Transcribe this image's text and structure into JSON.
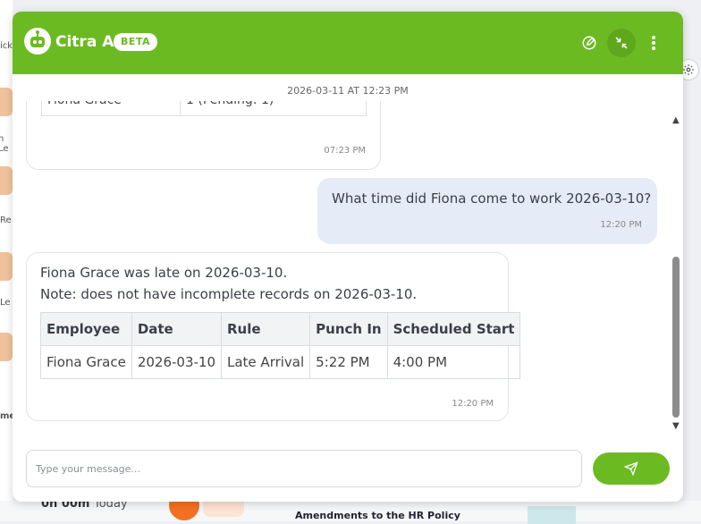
{
  "background": {
    "left_labels": [
      "ick",
      "n Le",
      "Re",
      "Le",
      "me"
    ],
    "bottom_time": "0h 00m",
    "bottom_time_suffix": "Today",
    "bottom_news": "Amendments to the HR Policy"
  },
  "chat": {
    "title": "Citra AI",
    "badge": "BETA",
    "date_separator": "2026-03-11 AT 12:23 PM",
    "messages": {
      "previous": {
        "table_row": [
          "Fiona Grace",
          "1 (Pending: 1)"
        ],
        "time": "07:23 PM"
      },
      "user": {
        "text": "What time did Fiona come to work 2026-03-10?",
        "time": "12:20 PM"
      },
      "bot": {
        "line1": "Fiona Grace was late on 2026-03-10.",
        "line2": "Note: does not have incomplete records on 2026-03-10.",
        "table": {
          "headers": [
            "Employee",
            "Date",
            "Rule",
            "Punch In",
            "Scheduled Start"
          ],
          "rows": [
            [
              "Fiona Grace",
              "2026-03-10",
              "Late Arrival",
              "5:22 PM",
              "4:00 PM"
            ]
          ]
        },
        "time": "12:20 PM"
      }
    },
    "input": {
      "placeholder": "Type your message...",
      "value": ""
    }
  },
  "colors": {
    "brand_green": "#6cba22",
    "user_bubble": "#e5ecf8"
  },
  "icons": [
    "robot-logo-icon",
    "edit-icon",
    "minimize-icon",
    "more-vertical-icon",
    "send-icon",
    "gear-icon"
  ]
}
